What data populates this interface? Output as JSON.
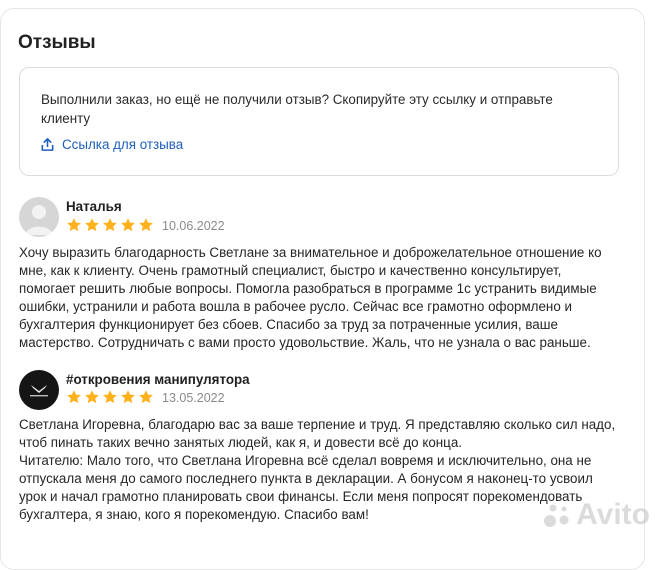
{
  "section": {
    "title": "Отзывы"
  },
  "invite": {
    "text": "Выполнили заказ, но ещё не получили отзыв? Скопируйте эту ссылку и отправьте клиенту",
    "link_label": "Ссылка для отзыва",
    "link_color": "#1f5fbf"
  },
  "reviews": [
    {
      "author": "Наталья",
      "rating": 5,
      "date": "10.06.2022",
      "avatar_icon": "user-placeholder-icon",
      "paragraphs": [
        "Хочу выразить благодарность Светлане за внимательное и доброжелательное отношение ко мне, как к клиенту. Очень грамотный специалист, быстро и качественно консультирует, помогает решить любые вопросы. Помогла разобраться в программе 1с устранить видимые ошибки, устранили и работа вошла в рабочее русло. Сейчас все грамотно оформлено и бухгалтерия функционирует без сбоев. Спасибо за труд за потраченные усилия, ваше мастерство. Сотрудничать с вами просто удовольствие. Жаль, что не узнала о вас раньше."
      ]
    },
    {
      "author": "#откровения манипулятора",
      "rating": 5,
      "date": "13.05.2022",
      "avatar_icon": "dark-logo-icon",
      "paragraphs": [
        "Светлана Игоревна, благодарю вас за ваше терпение и труд. Я представляю сколько сил надо, чтоб пинать таких вечно занятых людей, как я, и довести всё до конца.",
        "Читателю: Мало того, что Светлана Игоревна всё сделал вовремя и исключительно, она не отпускала меня до самого последнего пункта в декларации. А бонусом я наконец-то усвоил урок и начал грамотно планировать свои финансы. Если меня попросят порекомендовать бухгалтера, я знаю, кого я порекомендую. Спасибо вам!"
      ]
    }
  ],
  "colors": {
    "star": "#ffb11b",
    "accent": "#1f5fbf"
  },
  "watermark": {
    "text": "Avito"
  }
}
